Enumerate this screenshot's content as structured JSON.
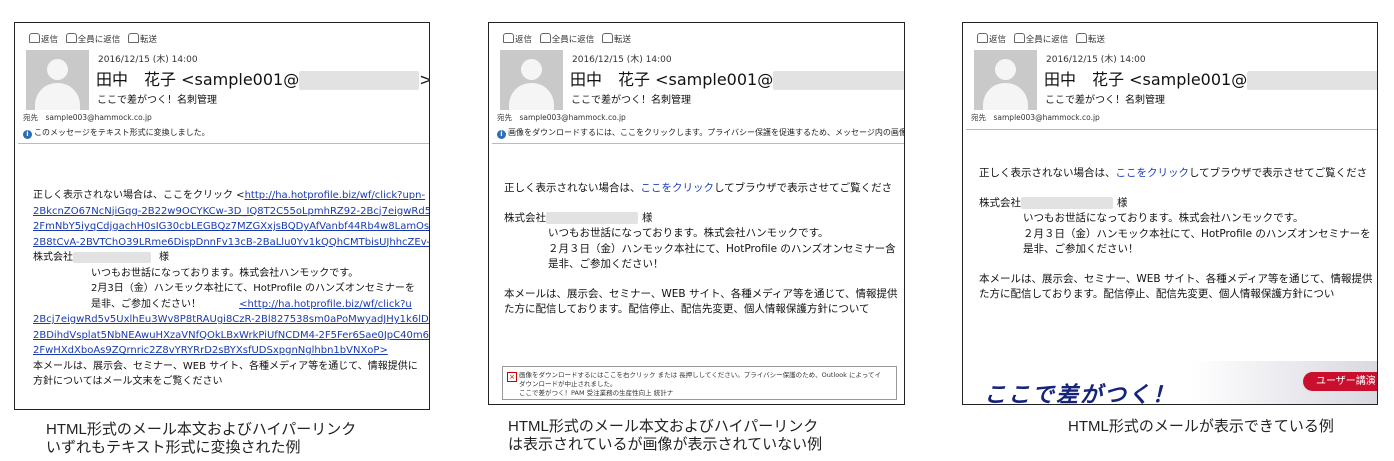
{
  "common": {
    "toolbar": {
      "reply": "返信",
      "reply_all": "全員に返信",
      "forward": "転送"
    },
    "date": "2016/12/15 (木) 14:00",
    "sender_prefix": "田中　花子 <sample001@",
    "sender_suffix": ">",
    "subject": "ここで差がつく！名刺管理",
    "to": "宛先　sample003@hammock.co.jp"
  },
  "panel1": {
    "info": "このメッセージをテキスト形式に変換しました。",
    "line1_prefix": "正しく表示されない場合は、ここをクリック <",
    "line1_link": "http://ha.hotprofile.biz/wf/click?upn-",
    "links_a": [
      "2BkcnZO67NcNjiGqg-2B22w9OCYKCw-3D_IQ8T2C55oLpmhRZ92-2Bcj7eigwRd5v5",
      "2FmNbY5iyqCdjgachH0sIG30cbLEGBQz7MZGXxjsBQDyAfVanbf44Rb4w8LamOsmn",
      "2B8tCvA-2BVTChO39LRme6DispDnnFv13cB-2BaLlu0Yv1kQQhCMTbisUJhhcZEv-2F"
    ],
    "company": "株式会社",
    "honorific": "様",
    "greeting": "いつもお世話になっております。株式会社ハンモックです。",
    "event": "2月3日（金）ハンモック本社にて、HotProfile のハンズオンセミナーを",
    "invite": "是非、ご参加ください！",
    "invite_link": "<http://ha.hotprofile.biz/wf/click?u",
    "links_b": [
      "2Bcj7eigwRd5v5UxlhEu3Wv8P8tRAUgi8CzR-2Bl827538sm0aPoMwyadJHy1k6lDCyH",
      "2BDihdVsplat5NbNEAwuHXzaVNfQOkLBxWrkPiUfNCDM4-2F5Fer6Sae0JpC40m6o0",
      "2FwHXdXboAs9ZQrnric2Z8vYRYRrD2sBYXsfUDSxpgnNglhbn1bVNXoP>"
    ],
    "para1": "本メールは、展示会、セミナー、WEB サイト、各種メディア等を通じて、情報提供に",
    "para2": "方針についてはメール文末をご覧ください"
  },
  "panel2": {
    "info": "画像をダウンロードするには、ここをクリックします。プライバシー保護を促進するため、メッセージ内の画像は自動",
    "line1_a": "正しく表示されない場合は、",
    "line1_link": "ここをクリック",
    "line1_b": "してブラウザで表示させてご覧くださ",
    "company": "株式会社",
    "honorific": "様",
    "greeting": "いつもお世話になっております。株式会社ハンモックです。",
    "event": "２月３日（金）ハンモック本社にて、HotProfile のハンズオンセミナー含",
    "invite": "是非、ご参加ください！",
    "para1": "本メールは、展示会、セミナー、WEB サイト、各種メディア等を通じて、情報提供",
    "para2": "た方に配信しております。配信停止、配信先変更、個人情報保護方針について",
    "notice1": "画像をダウンロードするにはここを右クリック または 長押ししてください。プライバシー保護のため、Outlook によってイ",
    "notice2": "ダウンロードが中止されました。",
    "notice3": "ここで差がつく！PAM 受注業務の生産性向上 統計ナ"
  },
  "panel3": {
    "line1_a": "正しく表示されない場合は、",
    "line1_link": "ここをクリック",
    "line1_b": "してブラウザで表示させてご覧くださ",
    "company": "株式会社",
    "honorific": "様",
    "greeting": "いつもお世話になっております。株式会社ハンモックです。",
    "event": "２月３日（金）ハンモック本社にて、HotProfile のハンズオンセミナーを",
    "invite": "是非、ご参加ください！",
    "para1": "本メールは、展示会、セミナー、WEB サイト、各種メディア等を通じて、情報提供",
    "para2": "た方に配信しております。配信停止、配信先変更、個人情報保護方針につい",
    "banner_text": "ここで差がつく！",
    "banner_button": "ユーザー講演"
  },
  "captions": {
    "c1_line1": "HTML形式のメール本文およびハイパーリンク",
    "c1_line2": "いずれもテキスト形式に変換された例",
    "c2_line1": "HTML形式のメール本文およびハイパーリンク",
    "c2_line2": "は表示されているが画像が表示されていない例",
    "c3_line1": "HTML形式のメールが表示できている例"
  }
}
